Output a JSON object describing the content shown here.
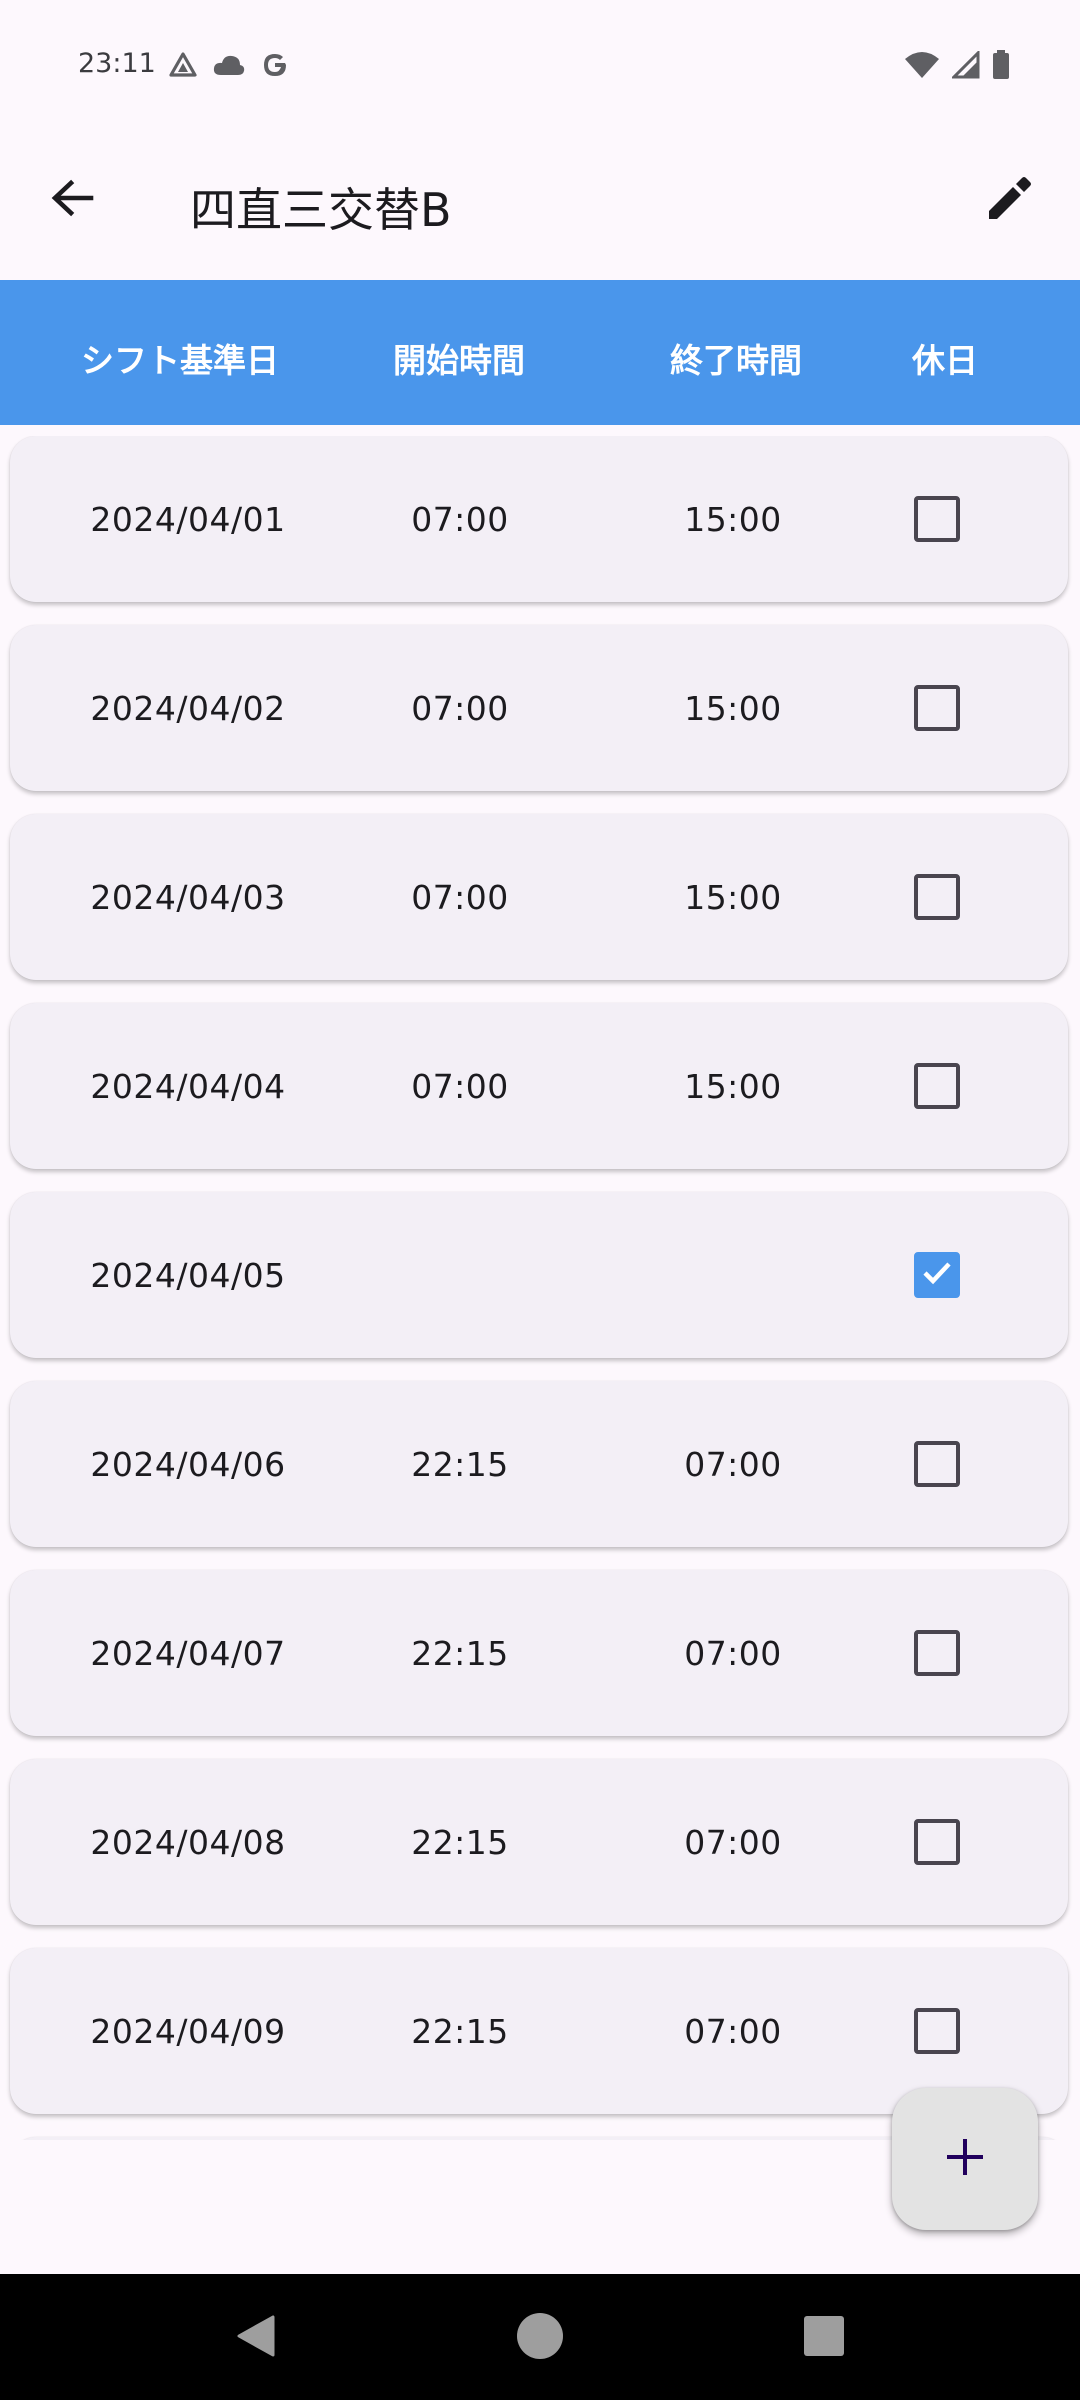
{
  "status_bar": {
    "time": "23:11",
    "left_icons": [
      "drive-icon",
      "cloud-icon",
      "google-icon"
    ],
    "right_icons": [
      "wifi-icon",
      "signal-icon",
      "battery-icon"
    ]
  },
  "app_bar": {
    "title": "四直三交替B",
    "back_icon": "arrow-back-icon",
    "edit_icon": "pencil-icon"
  },
  "table": {
    "headers": {
      "date": "シフト基準日",
      "start": "開始時間",
      "end": "終了時間",
      "holiday": "休日"
    },
    "rows": [
      {
        "date": "2024/04/01",
        "start": "07:00",
        "end": "15:00",
        "holiday": false
      },
      {
        "date": "2024/04/02",
        "start": "07:00",
        "end": "15:00",
        "holiday": false
      },
      {
        "date": "2024/04/03",
        "start": "07:00",
        "end": "15:00",
        "holiday": false
      },
      {
        "date": "2024/04/04",
        "start": "07:00",
        "end": "15:00",
        "holiday": false
      },
      {
        "date": "2024/04/05",
        "start": "",
        "end": "",
        "holiday": true
      },
      {
        "date": "2024/04/06",
        "start": "22:15",
        "end": "07:00",
        "holiday": false
      },
      {
        "date": "2024/04/07",
        "start": "22:15",
        "end": "07:00",
        "holiday": false
      },
      {
        "date": "2024/04/08",
        "start": "22:15",
        "end": "07:00",
        "holiday": false
      },
      {
        "date": "2024/04/09",
        "start": "22:15",
        "end": "07:00",
        "holiday": false
      }
    ]
  },
  "fab": {
    "icon": "plus-icon"
  },
  "colors": {
    "header_bg": "#4a96eb",
    "checkbox_checked": "#4a96eb",
    "row_bg": "#f3eff6",
    "page_bg": "#fdf8fd"
  },
  "nav_bar": {
    "icons": [
      "nav-back-icon",
      "nav-home-icon",
      "nav-recents-icon"
    ]
  }
}
